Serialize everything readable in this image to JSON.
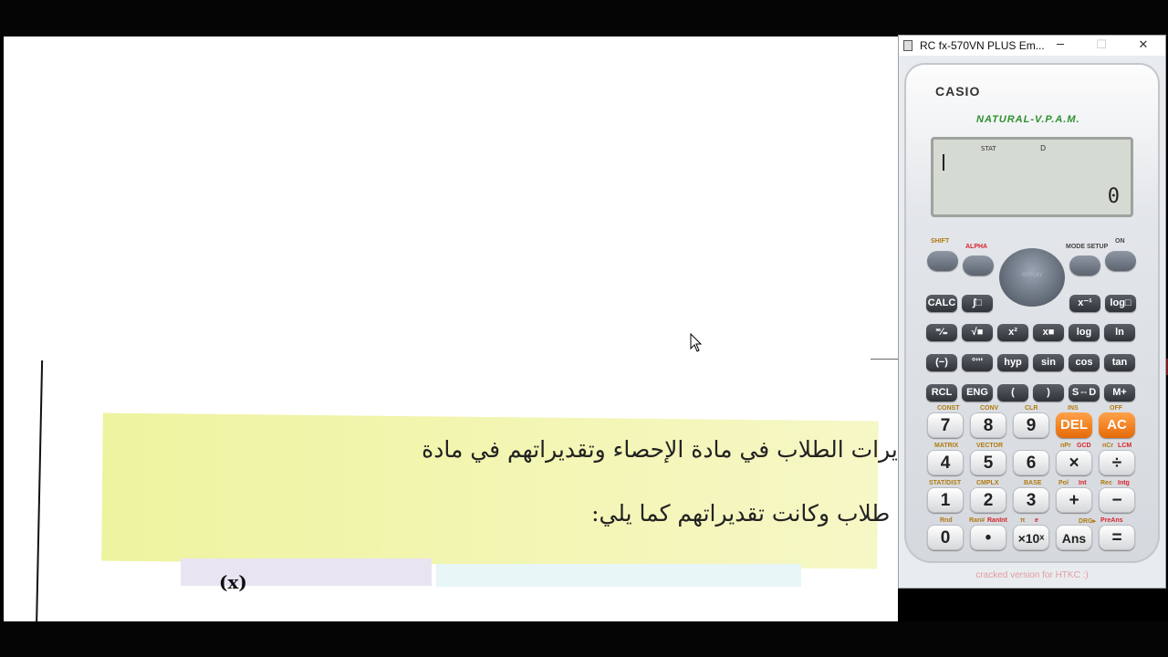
{
  "document": {
    "line1": "لدراسة علاقة ارتباط تقديرات الطلاب في مادة الإحصاء وتقديراتهم في مادة",
    "line2": "الرياضيات، اخترنا خمسة طلاب وكانت تقديراتهم كما يلي:",
    "table_peek": "(x)"
  },
  "calculator_window": {
    "title": "RC fx-570VN PLUS Em...",
    "minimize": "─",
    "maximize": "☐",
    "close": "✕",
    "footer": "cracked version for HTKC :)"
  },
  "calculator": {
    "brand": "CASIO",
    "model": "NATURAL-V.P.A.M.",
    "indicator_stat": "STAT",
    "indicator_d": "D",
    "result": "0",
    "replay": "REPLAY",
    "top_labels": {
      "shift": "SHIFT",
      "alpha": "ALPHA",
      "mode": "MODE SETUP",
      "on": "ON"
    },
    "row_a": [
      "CALC",
      "∫□",
      "x⁻¹",
      "log□"
    ],
    "row_b": [
      "⁼⁄₌",
      "√■",
      "x²",
      "x■",
      "log",
      "ln"
    ],
    "row_c": [
      "(−)",
      "°'''",
      "hyp",
      "sin",
      "cos",
      "tan"
    ],
    "row_d": [
      "RCL",
      "ENG",
      "(",
      ")",
      "S⇔D",
      "M+"
    ],
    "row_e": [
      "7",
      "8",
      "9",
      "DEL",
      "AC"
    ],
    "row_f": [
      "4",
      "5",
      "6",
      "×",
      "÷"
    ],
    "row_g": [
      "1",
      "2",
      "3",
      "+",
      "−"
    ],
    "row_h": [
      "0",
      "•",
      "×10ˣ",
      "Ans",
      "="
    ],
    "labels_e": [
      "CONST",
      "CONV",
      "CLR",
      "INS",
      "OFF"
    ],
    "labels_f": [
      "MATRIX",
      "VECTOR",
      "nPr",
      "GCD",
      "nCr",
      "LCM"
    ],
    "labels_g": [
      "STAT/DIST",
      "CMPLX",
      "BASE",
      "Pol",
      "Int",
      "Rec",
      "Intg"
    ],
    "labels_h": [
      "Rnd",
      "Ran#",
      "RanInt",
      "π",
      "e",
      "DRG▸",
      "PreAns"
    ]
  }
}
